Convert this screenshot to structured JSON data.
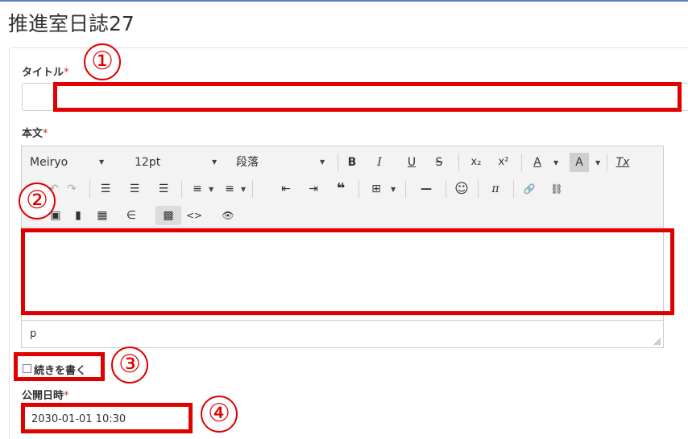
{
  "page": {
    "title": "推進室日誌27",
    "required_mark": "*"
  },
  "title_field": {
    "label": "タイトル",
    "value": ""
  },
  "body_field": {
    "label": "本文",
    "toolbar": {
      "font_family": "Meiryo",
      "font_size": "12pt",
      "block_format": "段落",
      "bold": "B",
      "italic": "I",
      "underline": "U",
      "strikethrough": "S",
      "subscript": "x₂",
      "superscript": "x²",
      "text_color": "A",
      "bg_color": "A",
      "clear_format": "Tx",
      "blockquote": "❝",
      "hr": "—",
      "emoticon": "☺",
      "math": "π",
      "link": "🔗",
      "unlink": "⛓",
      "code": "<>",
      "preview": "👁",
      "caret": "▼"
    },
    "status_path": "p"
  },
  "continue_checkbox": {
    "label": "続きを書く",
    "checked": false
  },
  "publish_field": {
    "label": "公開日時",
    "value": "2030-01-01 10:30"
  },
  "annotations": [
    {
      "number": "①"
    },
    {
      "number": "②"
    },
    {
      "number": "③"
    },
    {
      "number": "④"
    }
  ],
  "colors": {
    "highlight": "#e00000",
    "required": "#c9302c",
    "toolbar_bg": "#f3f3f3"
  }
}
